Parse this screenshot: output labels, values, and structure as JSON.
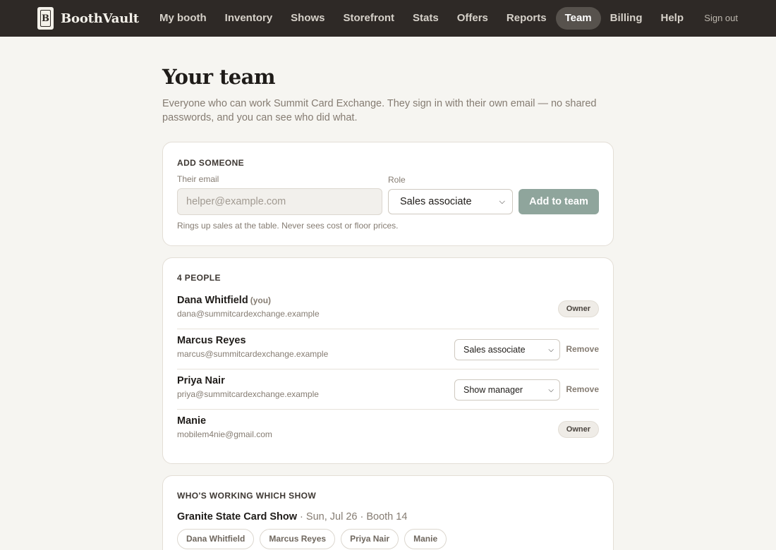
{
  "brand": {
    "name": "BoothVault",
    "logo_letter": "B",
    "logo_icon": "booth-vault-logo"
  },
  "nav": {
    "items": [
      {
        "label": "My booth",
        "active": false
      },
      {
        "label": "Inventory",
        "active": false
      },
      {
        "label": "Shows",
        "active": false
      },
      {
        "label": "Storefront",
        "active": false
      },
      {
        "label": "Stats",
        "active": false
      },
      {
        "label": "Offers",
        "active": false
      },
      {
        "label": "Reports",
        "active": false
      },
      {
        "label": "Team",
        "active": true
      },
      {
        "label": "Billing",
        "active": false
      },
      {
        "label": "Help",
        "active": false
      }
    ],
    "sign_out": "Sign out"
  },
  "page": {
    "title": "Your team",
    "subtitle": "Everyone who can work Summit Card Exchange. They sign in with their own email — no shared passwords, and you can see who did what."
  },
  "add_card": {
    "title": "Add someone",
    "email_label": "Their email",
    "email_placeholder": "helper@example.com",
    "email_value": "",
    "role_label": "Role",
    "role_value": "Sales associate",
    "add_button": "Add to team",
    "role_hint": "Rings up sales at the table. Never sees cost or floor prices."
  },
  "people_card": {
    "title": "4 people",
    "people": [
      {
        "name": "Dana Whitfield",
        "you_tag": "(you)",
        "email": "dana@summitcardexchange.example",
        "badge": "Owner"
      },
      {
        "name": "Marcus Reyes",
        "email": "marcus@summitcardexchange.example",
        "role": "Sales associate",
        "remove": "Remove"
      },
      {
        "name": "Priya Nair",
        "email": "priya@summitcardexchange.example",
        "role": "Show manager",
        "remove": "Remove"
      },
      {
        "name": "Manie",
        "email": "mobilem4nie@gmail.com",
        "badge": "Owner"
      }
    ]
  },
  "shows_card": {
    "title": "Who's working which show",
    "show_name": "Granite State Card Show",
    "show_details": " · Sun, Jul 26 · Booth 14",
    "chips": [
      "Dana Whitfield",
      "Marcus Reyes",
      "Priya Nair",
      "Manie"
    ]
  },
  "colors": {
    "topbar": "#2e2926",
    "accent_button": "#8fa59c",
    "page_bg": "#f6f5f1"
  }
}
